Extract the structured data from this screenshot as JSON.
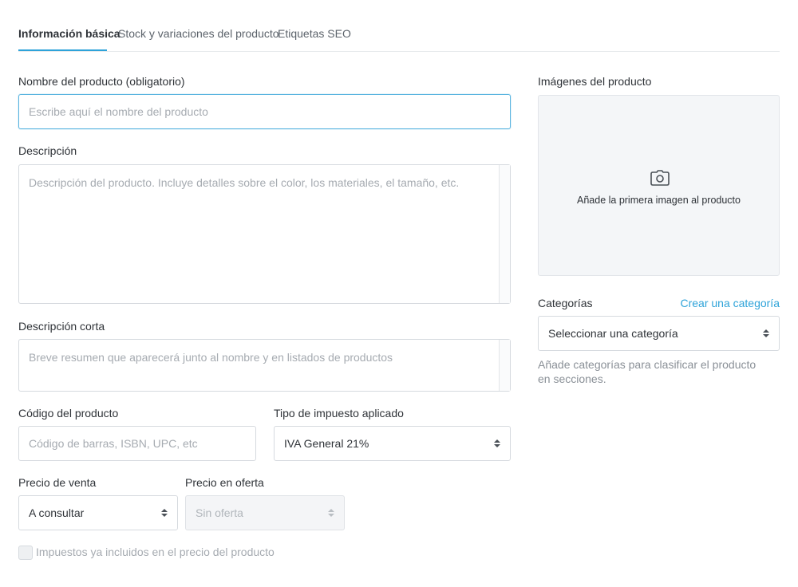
{
  "tabs": [
    {
      "label": "Información básica",
      "active": true
    },
    {
      "label": "Stock y variaciones del producto",
      "active": false
    },
    {
      "label": "Etiquetas SEO",
      "active": false
    }
  ],
  "product_name": {
    "label": "Nombre del producto (obligatorio)",
    "value": "",
    "placeholder": "Escribe aquí el nombre del producto"
  },
  "description": {
    "label": "Descripción",
    "value": "",
    "placeholder": "Descripción del producto. Incluye detalles sobre el color, los materiales, el tamaño, etc."
  },
  "short_description": {
    "label": "Descripción corta",
    "value": "",
    "placeholder": "Breve resumen que aparecerá junto al nombre y en listados de productos"
  },
  "product_code": {
    "label": "Código del producto",
    "value": "",
    "placeholder": "Código de barras, ISBN, UPC, etc"
  },
  "tax_type": {
    "label": "Tipo de impuesto aplicado",
    "selected": "IVA General 21%"
  },
  "sale_price": {
    "label": "Precio de venta",
    "selected": "A consultar"
  },
  "offer_price": {
    "label": "Precio en oferta",
    "selected": "Sin oferta",
    "disabled": true
  },
  "taxes_included": {
    "label": "Impuestos ya incluidos en el precio del producto",
    "checked": false
  },
  "images": {
    "label": "Imágenes del producto",
    "add_text": "Añade la primera imagen al producto",
    "icon": "camera-icon"
  },
  "categories": {
    "label": "Categorías",
    "create_link": "Crear una categoría",
    "selected": "Seleccionar una categoría",
    "help": "Añade categorías para clasificar el producto en secciones."
  },
  "colors": {
    "accent": "#2ea3d9",
    "focus_border": "#5ab4e0",
    "image_bg": "#f4f6f8"
  }
}
